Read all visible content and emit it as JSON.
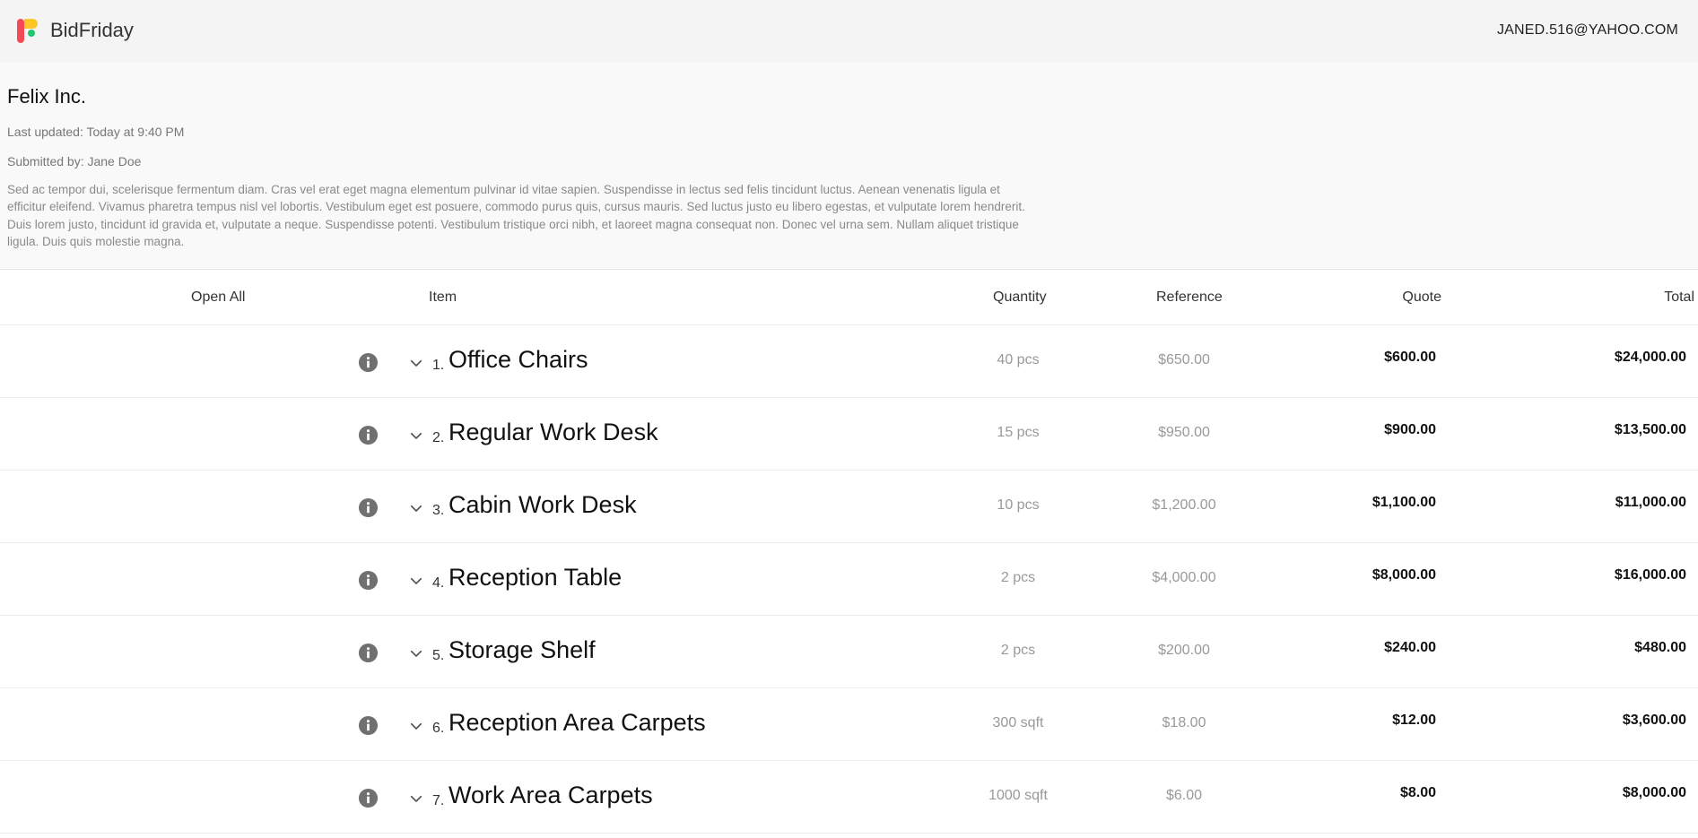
{
  "app": {
    "brand": "BidFriday",
    "user_email": "JANED.516@YAHOO.COM"
  },
  "summary": {
    "company": "Felix Inc.",
    "last_updated": "Last updated: Today at 9:40 PM",
    "submitted_by": "Submitted by: Jane Doe",
    "description": "Sed ac tempor dui, scelerisque fermentum diam. Cras vel erat eget magna elementum pulvinar id vitae sapien. Suspendisse in lectus sed felis tincidunt luctus. Aenean venenatis ligula et efficitur eleifend. Vivamus pharetra tempus nisl vel lobortis. Vestibulum eget est posuere, commodo purus quis, cursus mauris. Sed luctus justo eu libero egestas, et vulputate lorem hendrerit. Duis lorem justo, tincidunt id gravida et, vulputate a neque. Suspendisse potenti. Vestibulum tristique orci nibh, et laoreet magna consequat non. Donec vel urna sem. Nullam aliquet tristique ligula. Duis quis molestie magna."
  },
  "table": {
    "headers": {
      "open_all": "Open All",
      "item": "Item",
      "quantity": "Quantity",
      "reference": "Reference",
      "quote": "Quote",
      "total": "Total"
    },
    "rows": [
      {
        "num": "1.",
        "name": "Office Chairs",
        "quantity": "40 pcs",
        "reference": "$650.00",
        "quote": "$600.00",
        "total": "$24,000.00"
      },
      {
        "num": "2.",
        "name": "Regular Work Desk",
        "quantity": "15 pcs",
        "reference": "$950.00",
        "quote": "$900.00",
        "total": "$13,500.00"
      },
      {
        "num": "3.",
        "name": "Cabin Work Desk",
        "quantity": "10 pcs",
        "reference": "$1,200.00",
        "quote": "$1,100.00",
        "total": "$11,000.00"
      },
      {
        "num": "4.",
        "name": "Reception Table",
        "quantity": "2 pcs",
        "reference": "$4,000.00",
        "quote": "$8,000.00",
        "total": "$16,000.00"
      },
      {
        "num": "5.",
        "name": "Storage Shelf",
        "quantity": "2 pcs",
        "reference": "$200.00",
        "quote": "$240.00",
        "total": "$480.00"
      },
      {
        "num": "6.",
        "name": "Reception Area Carpets",
        "quantity": "300 sqft",
        "reference": "$18.00",
        "quote": "$12.00",
        "total": "$3,600.00"
      },
      {
        "num": "7.",
        "name": "Work Area Carpets",
        "quantity": "1000 sqft",
        "reference": "$6.00",
        "quote": "$8.00",
        "total": "$8,000.00"
      }
    ]
  },
  "icons": {
    "row_info": "info-icon",
    "row_expand": "chevron-down-icon"
  },
  "colors": {
    "logo_red": "#f44a55",
    "logo_yellow": "#ffc629",
    "logo_green": "#1fc66f",
    "header_bg": "#f4f4f4",
    "muted_text": "#999999"
  }
}
